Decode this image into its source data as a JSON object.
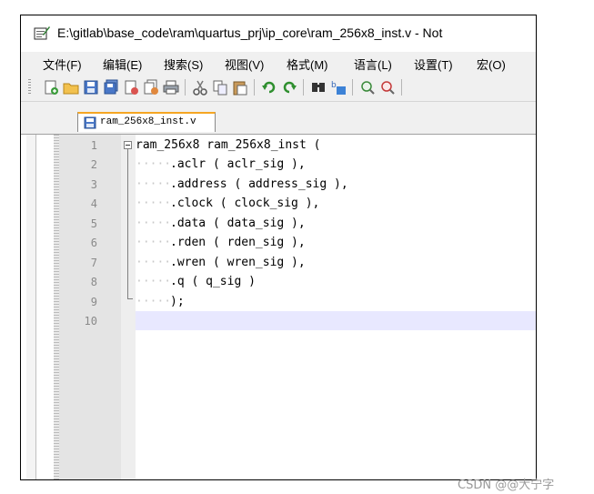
{
  "window": {
    "title": "E:\\gitlab\\base_code\\ram\\quartus_prj\\ip_core\\ram_256x8_inst.v - Not"
  },
  "menu": [
    {
      "label": "文件(F)"
    },
    {
      "label": "编辑(E)"
    },
    {
      "label": "搜索(S)"
    },
    {
      "label": "视图(V)"
    },
    {
      "label": "格式(M)"
    },
    {
      "label": "语言(L)"
    },
    {
      "label": "设置(T)"
    },
    {
      "label": "宏(O)"
    }
  ],
  "toolbar": {
    "icons": [
      "new-file-icon",
      "open-file-icon",
      "save-icon",
      "save-all-icon",
      "close-icon",
      "close-all-icon",
      "print-icon",
      "cut-icon",
      "copy-icon",
      "paste-icon",
      "undo-icon",
      "redo-icon",
      "find-icon",
      "replace-icon",
      "zoom-in-icon",
      "zoom-out-icon"
    ]
  },
  "tab": {
    "label": "ram_256x8_inst.v"
  },
  "editor": {
    "lines": [
      {
        "num": "1",
        "text": "ram_256x8 ram_256x8_inst ("
      },
      {
        "num": "2",
        "text": ".aclr ( aclr_sig ),"
      },
      {
        "num": "3",
        "text": ".address ( address_sig ),"
      },
      {
        "num": "4",
        "text": ".clock ( clock_sig ),"
      },
      {
        "num": "5",
        "text": ".data ( data_sig ),"
      },
      {
        "num": "6",
        "text": ".rden ( rden_sig ),"
      },
      {
        "num": "7",
        "text": ".wren ( wren_sig ),"
      },
      {
        "num": "8",
        "text": ".q ( q_sig )"
      },
      {
        "num": "9",
        "text": ");"
      },
      {
        "num": "10",
        "text": ""
      }
    ],
    "current_line_color": "#e8e8ff"
  },
  "watermark": "CSDN @@大宁字"
}
